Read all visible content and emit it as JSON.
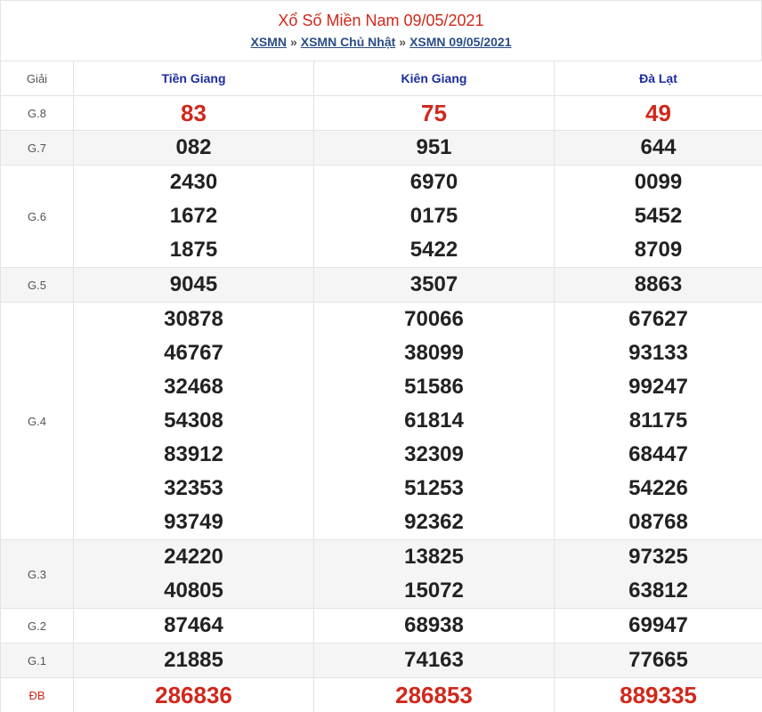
{
  "header": {
    "title": "Xổ Số Miền Nam 09/05/2021",
    "breadcrumb": [
      "XSMN",
      "XSMN Chủ Nhật",
      "XSMN 09/05/2021"
    ],
    "separator": "»"
  },
  "table": {
    "prize_header": "Giải",
    "provinces": [
      "Tiền Giang",
      "Kiên Giang",
      "Đà Lạt"
    ],
    "rows": [
      {
        "prize": "G.8",
        "values": [
          [
            "83"
          ],
          [
            "75"
          ],
          [
            "49"
          ]
        ],
        "highlight": true
      },
      {
        "prize": "G.7",
        "values": [
          [
            "082"
          ],
          [
            "951"
          ],
          [
            "644"
          ]
        ]
      },
      {
        "prize": "G.6",
        "values": [
          [
            "2430",
            "1672",
            "1875"
          ],
          [
            "6970",
            "0175",
            "5422"
          ],
          [
            "0099",
            "5452",
            "8709"
          ]
        ]
      },
      {
        "prize": "G.5",
        "values": [
          [
            "9045"
          ],
          [
            "3507"
          ],
          [
            "8863"
          ]
        ]
      },
      {
        "prize": "G.4",
        "values": [
          [
            "30878",
            "46767",
            "32468",
            "54308",
            "83912",
            "32353",
            "93749"
          ],
          [
            "70066",
            "38099",
            "51586",
            "61814",
            "32309",
            "51253",
            "92362"
          ],
          [
            "67627",
            "93133",
            "99247",
            "81175",
            "68447",
            "54226",
            "08768"
          ]
        ]
      },
      {
        "prize": "G.3",
        "values": [
          [
            "24220",
            "40805"
          ],
          [
            "13825",
            "15072"
          ],
          [
            "97325",
            "63812"
          ]
        ]
      },
      {
        "prize": "G.2",
        "values": [
          [
            "87464"
          ],
          [
            "68938"
          ],
          [
            "69947"
          ]
        ]
      },
      {
        "prize": "G.1",
        "values": [
          [
            "21885"
          ],
          [
            "74163"
          ],
          [
            "77665"
          ]
        ]
      },
      {
        "prize": "ĐB",
        "values": [
          [
            "286836"
          ],
          [
            "286853"
          ],
          [
            "889335"
          ]
        ],
        "highlight": true,
        "special": true
      }
    ]
  },
  "colors": {
    "red": "#d0281c",
    "blue": "#1d2ca0",
    "link": "#2a4d87"
  }
}
